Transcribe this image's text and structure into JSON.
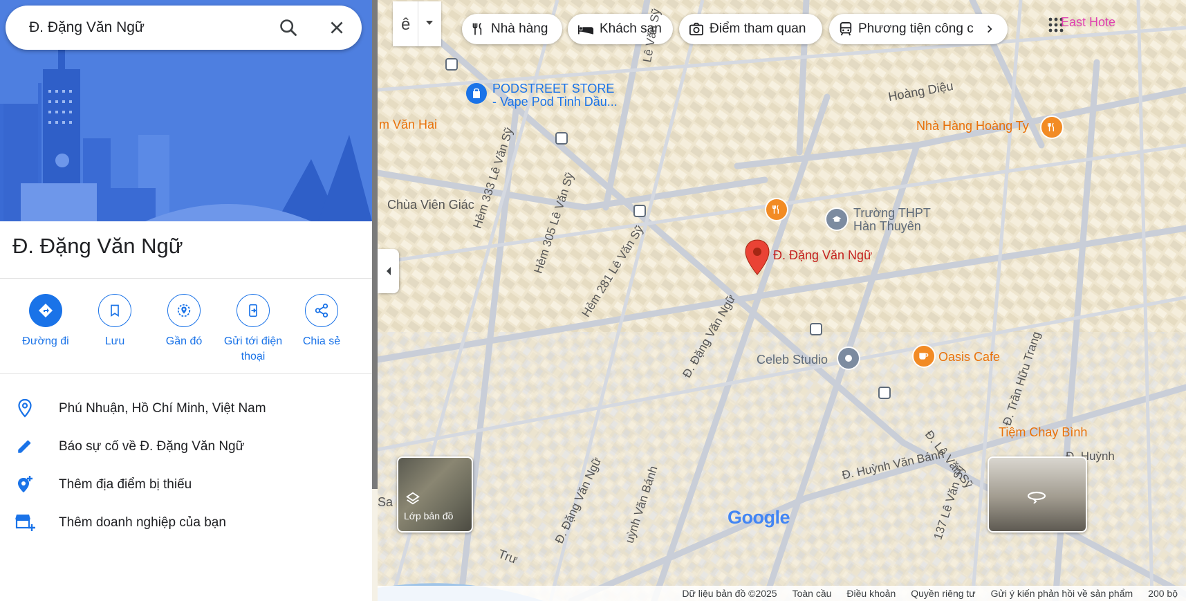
{
  "search": {
    "value": "Đ. Đặng Văn Ngữ"
  },
  "place": {
    "title": "Đ. Đặng Văn Ngữ"
  },
  "actions": [
    {
      "label": "Đường đi"
    },
    {
      "label": "Lưu"
    },
    {
      "label": "Gần đó"
    },
    {
      "label": "Gửi tới điện thoại"
    },
    {
      "label": "Chia sẻ"
    }
  ],
  "info": [
    {
      "icon": "location-pin-icon",
      "text": "Phú Nhuận, Hồ Chí Minh, Việt Nam"
    },
    {
      "icon": "pencil-icon",
      "text": "Báo sự cố về Đ. Đặng Văn Ngữ"
    },
    {
      "icon": "add-location-icon",
      "text": "Thêm địa điểm bị thiếu"
    },
    {
      "icon": "add-business-icon",
      "text": "Thêm doanh nghiệp của bạn"
    }
  ],
  "chips": [
    {
      "icon": "restaurant-icon",
      "label": "Nhà hàng"
    },
    {
      "icon": "hotel-icon",
      "label": "Khách sạn"
    },
    {
      "icon": "camera-icon",
      "label": "Điểm tham quan"
    },
    {
      "icon": "transit-icon",
      "label": "Phương tiện công c"
    }
  ],
  "map_labels": {
    "podstreet_line1": "PODSTREET STORE",
    "podstreet_line2": "- Vape Pod Tinh Dầu...",
    "van_hai": "m Văn Hai",
    "hoang_dieu": "Hoàng Diệu",
    "nha_hang_hoang_ty": "Nhà Hàng Hoàng Ty",
    "chua_vien_giac": "Chùa Viên Giác",
    "truong_line1": "Trường THPT",
    "truong_line2": "Hàn Thuyên",
    "pin_label": "Đ. Đặng Văn Ngữ",
    "celeb_studio": "Celeb Studio",
    "oasis_cafe": "Oasis Cafe",
    "tiem_chay": "Tiệm Chay Bình",
    "east_hotel": "East Hote",
    "hem333": "Hẻm 333 Lê Văn Sỹ",
    "hem305": "Hẻm 305 Lê Văn Sỹ",
    "hem281": "Hẻm 281 Lê Văn Sỹ",
    "dang_van_ngu_road": "Đ. Đặng Văn Ngữ",
    "dang_van_ngu_road2": "Đ. Đặng Văn Ngữ",
    "huynh_van_banh": "Đ. Huỳnh Văn Bánh",
    "huynh_van_banh2": "uỳnh Văn Bánh",
    "le_van_sy": "Đ. Lê Văn Sỹ",
    "le_van_sy137": "137 Lê Văn Sỹ",
    "tran_huu_trang": "Đ. Trần Hữu Trang",
    "le_van_sy_top": "Lê Văn Sỹ",
    "huynh_top": "Đ. Huỳnh",
    "sa": "Sa",
    "tru": "Trư"
  },
  "layers": {
    "label": "Lớp bản đồ"
  },
  "google_logo": "Google",
  "footer": {
    "map_data": "Dữ liệu bản đồ ©2025",
    "global": "Toàn cầu",
    "terms": "Điều khoản",
    "privacy": "Quyền riêng tư",
    "feedback": "Gửi ý kiến phản hồi về sản phẩm",
    "scale": "200 bộ"
  },
  "colors": {
    "accent": "#1a73e8",
    "hero_bg": "#4e7fe0",
    "pin_red": "#ea4335",
    "poi_orange": "#f28b24",
    "map_label_blue": "#1a73e8",
    "map_label_orange": "#e8710a"
  }
}
